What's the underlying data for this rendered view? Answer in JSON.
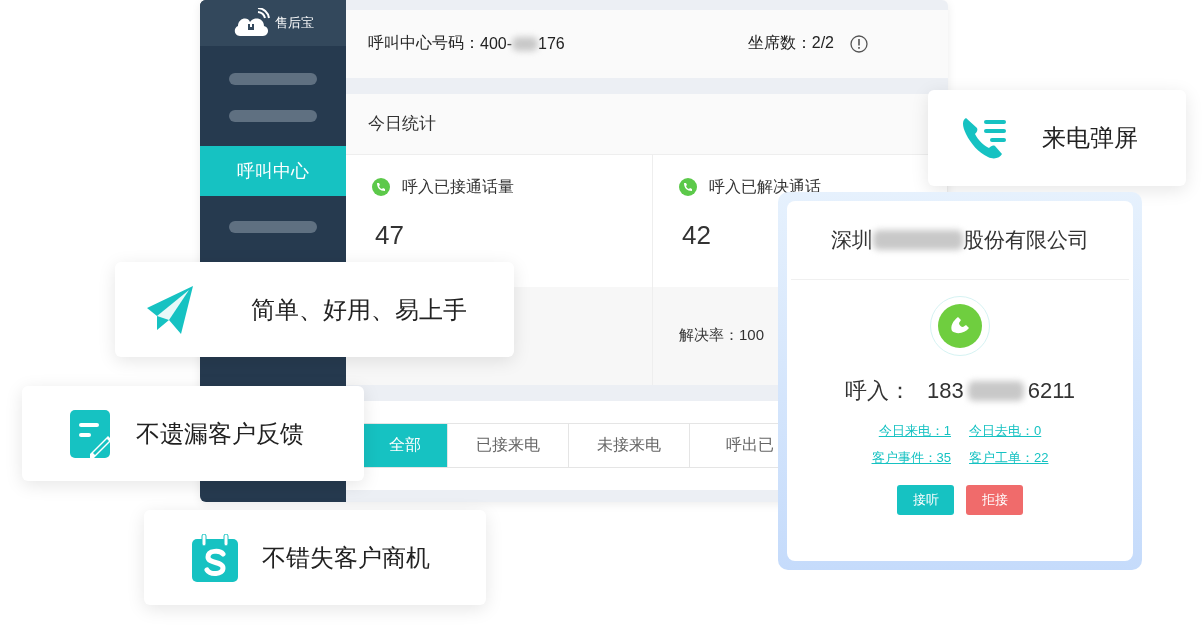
{
  "sidebar": {
    "logo_text": "售后宝",
    "items": [
      {
        "kind": "placeholder",
        "selected": false
      },
      {
        "kind": "placeholder",
        "selected": false
      },
      {
        "kind": "label",
        "label": "呼叫中心",
        "selected": true
      },
      {
        "kind": "placeholder",
        "selected": false
      }
    ]
  },
  "header": {
    "number_label": "呼叫中心号码：",
    "number_start": "400-",
    "number_end": "176",
    "seats": "坐席数：2/2"
  },
  "stats": {
    "title": "今日统计",
    "cells": [
      {
        "label": "呼入已接通话量",
        "value": "47"
      },
      {
        "label": "呼入已解决通话",
        "value": "42",
        "rate": "解决率：100"
      }
    ]
  },
  "tabs": [
    {
      "label": "全部",
      "selected": true
    },
    {
      "label": "已接来电",
      "selected": false
    },
    {
      "label": "未接来电",
      "selected": false
    },
    {
      "label": "呼出已",
      "selected": false
    }
  ],
  "badge": {
    "kind": "phone-list",
    "text": "来电弹屏"
  },
  "incoming_call": {
    "company_start": "深圳",
    "company_end": "股份有限公司",
    "caller_label": "呼入：",
    "number_start": "183",
    "number_end": "6211",
    "links": [
      "今日来电：1",
      "今日去电：0",
      "客户事件：35",
      "客户工单：22"
    ],
    "buttons": [
      {
        "kind": "accept",
        "label": "接听"
      },
      {
        "kind": "reject",
        "label": "拒接"
      }
    ]
  },
  "features": [
    {
      "kind": "plane",
      "text": "简单、好用、易上手"
    },
    {
      "kind": "note",
      "text": "不遗漏客户反馈"
    },
    {
      "kind": "calendar",
      "text": "不错失客户商机"
    }
  ]
}
